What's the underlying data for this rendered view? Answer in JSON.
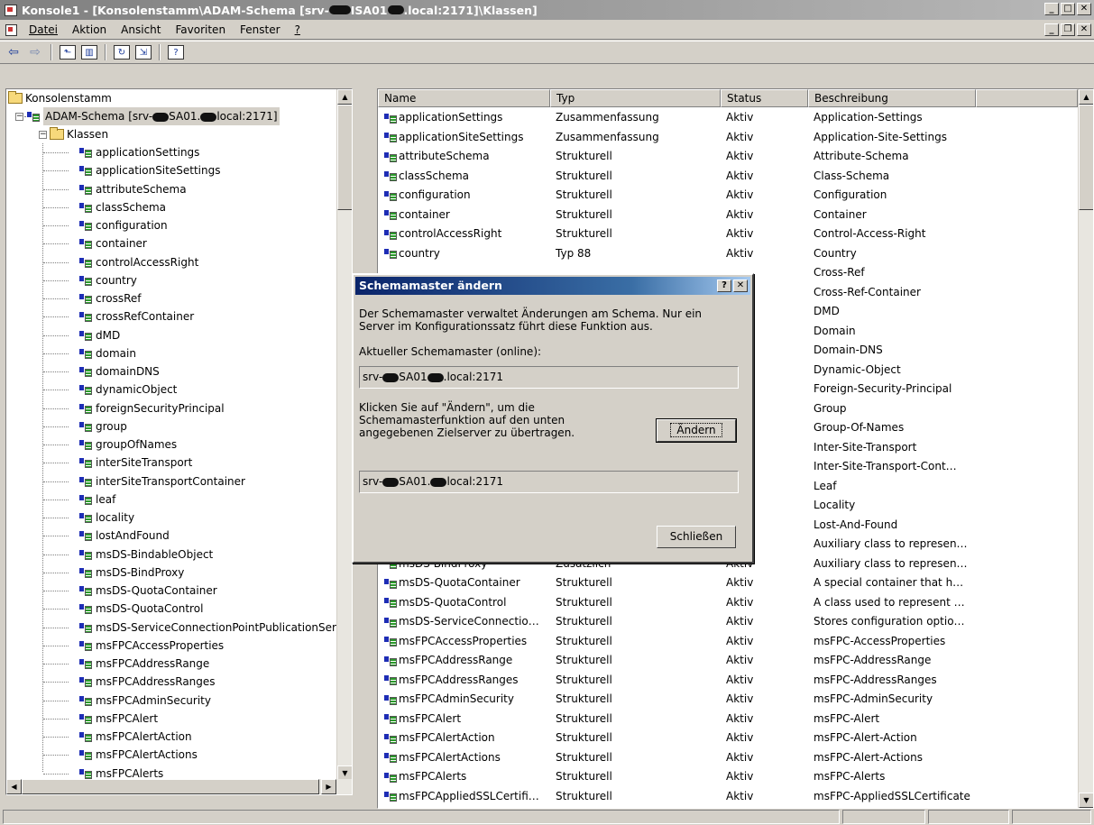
{
  "window": {
    "title_prefix": "Konsole1 - [Konsolenstamm\\ADAM-Schema [srv-",
    "title_mid": "ISA01",
    "title_suffix": ".local:2171]\\Klassen]"
  },
  "menu": [
    "Datei",
    "Aktion",
    "Ansicht",
    "Favoriten",
    "Fenster",
    "?"
  ],
  "toolbar": {
    "icons": [
      "back-arrow-icon",
      "forward-arrow-icon",
      "up-folder-icon",
      "show-hide-tree-icon",
      "refresh-icon",
      "export-list-icon",
      "help-icon"
    ]
  },
  "tree": {
    "root": "Konsolenstamm",
    "adam_prefix": "ADAM-Schema [srv-",
    "adam_mid": "SA01.",
    "adam_suffix": "local:2171]",
    "klassen": "Klassen",
    "items": [
      "applicationSettings",
      "applicationSiteSettings",
      "attributeSchema",
      "classSchema",
      "configuration",
      "container",
      "controlAccessRight",
      "country",
      "crossRef",
      "crossRefContainer",
      "dMD",
      "domain",
      "domainDNS",
      "dynamicObject",
      "foreignSecurityPrincipal",
      "group",
      "groupOfNames",
      "interSiteTransport",
      "interSiteTransportContainer",
      "leaf",
      "locality",
      "lostAndFound",
      "msDS-BindableObject",
      "msDS-BindProxy",
      "msDS-QuotaContainer",
      "msDS-QuotaControl",
      "msDS-ServiceConnectionPointPublicationServi",
      "msFPCAccessProperties",
      "msFPCAddressRange",
      "msFPCAddressRanges",
      "msFPCAdminSecurity",
      "msFPCAlert",
      "msFPCAlertAction",
      "msFPCAlertActions",
      "msFPCAlerts"
    ]
  },
  "list": {
    "columns": [
      "Name",
      "Typ",
      "Status",
      "Beschreibung"
    ],
    "rows": [
      [
        "applicationSettings",
        "Zusammenfassung",
        "Aktiv",
        "Application-Settings"
      ],
      [
        "applicationSiteSettings",
        "Zusammenfassung",
        "Aktiv",
        "Application-Site-Settings"
      ],
      [
        "attributeSchema",
        "Strukturell",
        "Aktiv",
        "Attribute-Schema"
      ],
      [
        "classSchema",
        "Strukturell",
        "Aktiv",
        "Class-Schema"
      ],
      [
        "configuration",
        "Strukturell",
        "Aktiv",
        "Configuration"
      ],
      [
        "container",
        "Strukturell",
        "Aktiv",
        "Container"
      ],
      [
        "controlAccessRight",
        "Strukturell",
        "Aktiv",
        "Control-Access-Right"
      ],
      [
        "country",
        "Typ 88",
        "Aktiv",
        "Country"
      ],
      [
        "",
        "",
        "",
        "Cross-Ref"
      ],
      [
        "",
        "",
        "",
        "Cross-Ref-Container"
      ],
      [
        "",
        "",
        "",
        "DMD"
      ],
      [
        "",
        "",
        "",
        "Domain"
      ],
      [
        "",
        "",
        "",
        "Domain-DNS"
      ],
      [
        "",
        "",
        "",
        "Dynamic-Object"
      ],
      [
        "",
        "",
        "",
        "Foreign-Security-Principal"
      ],
      [
        "",
        "",
        "",
        "Group"
      ],
      [
        "",
        "",
        "",
        "Group-Of-Names"
      ],
      [
        "",
        "",
        "",
        "Inter-Site-Transport"
      ],
      [
        "",
        "",
        "",
        "Inter-Site-Transport-Cont…"
      ],
      [
        "",
        "",
        "",
        "Leaf"
      ],
      [
        "",
        "",
        "",
        "Locality"
      ],
      [
        "",
        "",
        "",
        "Lost-And-Found"
      ],
      [
        "",
        "",
        "",
        "Auxiliary class to represen…"
      ],
      [
        "msDS-BindProxy",
        "Zusätzlich",
        "Aktiv",
        "Auxiliary class to represen…"
      ],
      [
        "msDS-QuotaContainer",
        "Strukturell",
        "Aktiv",
        "A special container that h…"
      ],
      [
        "msDS-QuotaControl",
        "Strukturell",
        "Aktiv",
        "A class used to represent …"
      ],
      [
        "msDS-ServiceConnectio…",
        "Strukturell",
        "Aktiv",
        "Stores configuration optio…"
      ],
      [
        "msFPCAccessProperties",
        "Strukturell",
        "Aktiv",
        "msFPC-AccessProperties"
      ],
      [
        "msFPCAddressRange",
        "Strukturell",
        "Aktiv",
        "msFPC-AddressRange"
      ],
      [
        "msFPCAddressRanges",
        "Strukturell",
        "Aktiv",
        "msFPC-AddressRanges"
      ],
      [
        "msFPCAdminSecurity",
        "Strukturell",
        "Aktiv",
        "msFPC-AdminSecurity"
      ],
      [
        "msFPCAlert",
        "Strukturell",
        "Aktiv",
        "msFPC-Alert"
      ],
      [
        "msFPCAlertAction",
        "Strukturell",
        "Aktiv",
        "msFPC-Alert-Action"
      ],
      [
        "msFPCAlertActions",
        "Strukturell",
        "Aktiv",
        "msFPC-Alert-Actions"
      ],
      [
        "msFPCAlerts",
        "Strukturell",
        "Aktiv",
        "msFPC-Alerts"
      ],
      [
        "msFPCAppliedSSLCertifi…",
        "Strukturell",
        "Aktiv",
        "msFPC-AppliedSSLCertificate"
      ]
    ]
  },
  "dialog": {
    "title": "Schemamaster ändern",
    "desc_line1": "Der Schemamaster verwaltet Änderungen am Schema. Nur ein",
    "desc_line2": "Server im Konfigurationssatz führt diese Funktion aus.",
    "current_label": "Aktueller Schemamaster (online):",
    "current_prefix": "srv-",
    "current_mid": "SA01",
    "current_suffix": ".local:2171",
    "click_line1": "Klicken Sie auf \"Ändern\", um die",
    "click_line2": "Schemamasterfunktion auf den unten",
    "click_line3": "angegebenen Zielserver zu übertragen.",
    "change_button": "Ändern",
    "target_prefix": "srv-",
    "target_mid": "SA01.",
    "target_suffix": "local:2171",
    "close_button": "Schließen"
  },
  "colors": {
    "dialog_title_start": "#0a246a",
    "dialog_title_end": "#a6caf0",
    "class_icon_blue": "#1e2db5",
    "class_icon_green": "#2a9a2a"
  }
}
